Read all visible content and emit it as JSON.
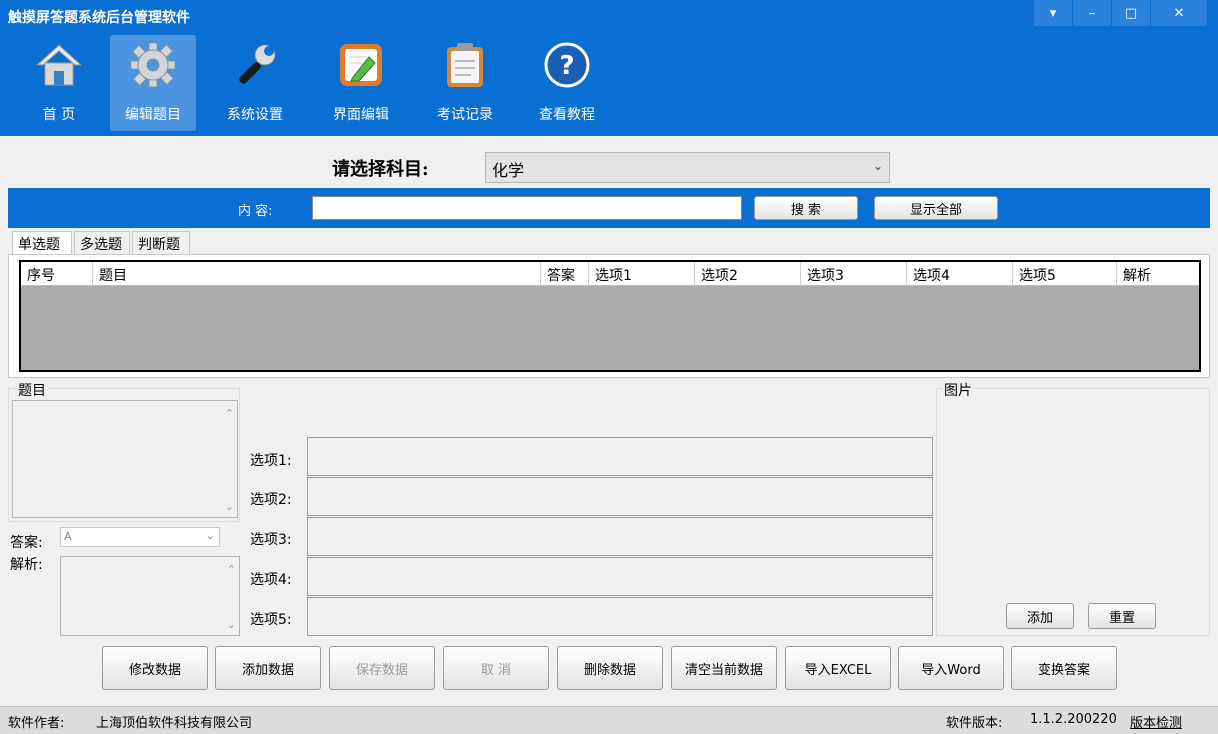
{
  "window": {
    "title": "触摸屏答题系统后台管理软件",
    "controls": {
      "menu": "▾",
      "minimize": "–",
      "maximize": "□",
      "close": "✕"
    }
  },
  "toolbar": {
    "items": [
      {
        "label": "首  页",
        "icon": "home-icon"
      },
      {
        "label": "编辑题目",
        "icon": "gear-icon",
        "active": true
      },
      {
        "label": "系统设置",
        "icon": "wrench-icon"
      },
      {
        "label": "界面编辑",
        "icon": "edit-pad-icon"
      },
      {
        "label": "考试记录",
        "icon": "clipboard-icon"
      },
      {
        "label": "查看教程",
        "icon": "help-icon",
        "help_glyph": "?"
      }
    ]
  },
  "subject": {
    "label": "请选择科目:",
    "value": "化学"
  },
  "search": {
    "label": "内  容:",
    "value": "",
    "search_button": "搜  索",
    "show_all_button": "显示全部"
  },
  "tabs": [
    {
      "label": "单选题",
      "active": true
    },
    {
      "label": "多选题"
    },
    {
      "label": "判断题"
    }
  ],
  "table": {
    "columns": [
      "序号",
      "题目",
      "答案",
      "选项1",
      "选项2",
      "选项3",
      "选项4",
      "选项5",
      "解析"
    ]
  },
  "form": {
    "question_label": "题目",
    "answer_label": "答案:",
    "answer_value": "A",
    "analysis_label": "解析:",
    "picture_label": "图片",
    "options": [
      "选项1:",
      "选项2:",
      "选项3:",
      "选项4:",
      "选项5:"
    ],
    "picture_add": "添加",
    "picture_reset": "重置",
    "scroll_up": "⌃",
    "scroll_down": "⌄",
    "dropdown_arrow": "⌄"
  },
  "actions": [
    {
      "label": "修改数据"
    },
    {
      "label": "添加数据"
    },
    {
      "label": "保存数据",
      "disabled": true
    },
    {
      "label": "取  消",
      "disabled": true
    },
    {
      "label": "删除数据"
    },
    {
      "label": "清空当前数据"
    },
    {
      "label": "导入EXCEL"
    },
    {
      "label": "导入Word"
    },
    {
      "label": "变换答案"
    }
  ],
  "status": {
    "author_label": "软件作者:",
    "author": "上海顶伯软件科技有限公司",
    "version_label": "软件版本:",
    "version": "1.1.2.200220",
    "check_update": "版本检测"
  },
  "colors": {
    "primary": "#0a6fd3",
    "active_tab": "#4a94e0",
    "grid_bg": "#ababab"
  }
}
